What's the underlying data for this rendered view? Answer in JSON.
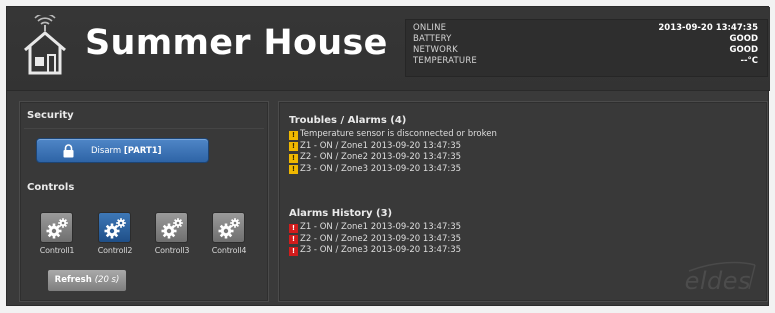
{
  "header": {
    "title": "Summer House",
    "status": [
      {
        "key": "ONLINE",
        "value": "2013-09-20 13:47:35"
      },
      {
        "key": "BATTERY",
        "value": "GOOD"
      },
      {
        "key": "NETWORK",
        "value": "GOOD"
      },
      {
        "key": "TEMPERATURE",
        "value": "--°C"
      }
    ]
  },
  "security": {
    "title": "Security",
    "disarm_label": "Disarm",
    "disarm_part": "[PART1]"
  },
  "controls": {
    "title": "Controls",
    "items": [
      {
        "label": "Controll1",
        "active": false
      },
      {
        "label": "Controll2",
        "active": true
      },
      {
        "label": "Controll3",
        "active": false
      },
      {
        "label": "Controll4",
        "active": false
      }
    ],
    "refresh_label": "Refresh",
    "refresh_timer": "(20 s)"
  },
  "troubles": {
    "title": "Troubles / Alarms (4)",
    "items": [
      "Temperature sensor is disconnected or broken",
      "Z1 - ON / Zone1 2013-09-20 13:47:35",
      "Z2 - ON / Zone2 2013-09-20 13:47:35",
      "Z3 - ON / Zone3 2013-09-20 13:47:35"
    ]
  },
  "history": {
    "title": "Alarms History (3)",
    "items": [
      "Z1 - ON / Zone1 2013-09-20 13:47:35",
      "Z2 - ON / Zone2 2013-09-20 13:47:35",
      "Z3 - ON / Zone3 2013-09-20 13:47:35"
    ]
  },
  "brand": "eldes",
  "colors": {
    "accent_blue": "#2e64a6",
    "warning": "#f0b800",
    "alarm": "#d21c1c"
  }
}
